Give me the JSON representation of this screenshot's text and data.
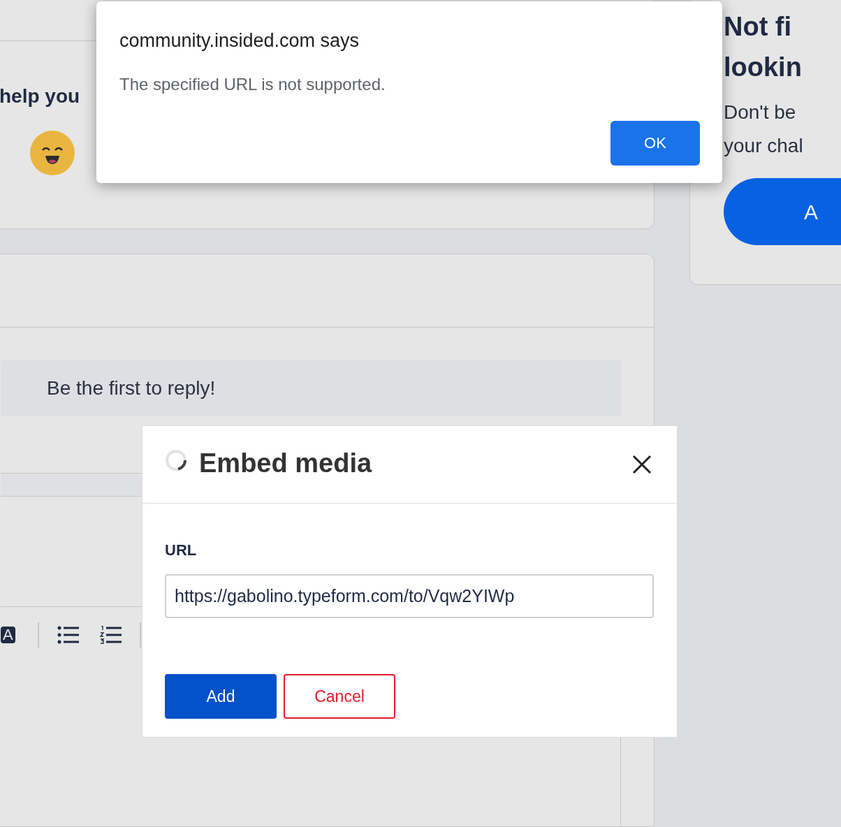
{
  "page": {
    "rating_prompt": "help you",
    "reply_notice": "Be the first to reply!",
    "toolbar": [
      {
        "kind": "text-color",
        "label": "A"
      },
      {
        "kind": "bullet-list"
      },
      {
        "kind": "numbered-list"
      }
    ]
  },
  "sidebar": {
    "heading_lines": [
      "Not fi",
      "lookin"
    ],
    "text_lines": [
      "Don't be",
      "your chal"
    ],
    "button": "A"
  },
  "alert": {
    "title": "community.insided.com says",
    "message": "The specified URL is not supported.",
    "button": "OK"
  },
  "embed_dialog": {
    "title": "Embed media",
    "loading": true,
    "url_label": "URL",
    "url_value": "https://gabolino.typeform.com/to/Vqw2YIWp",
    "buttons": [
      {
        "kind": "primary",
        "label": "Add"
      },
      {
        "kind": "cancel",
        "label": "Cancel"
      }
    ]
  }
}
